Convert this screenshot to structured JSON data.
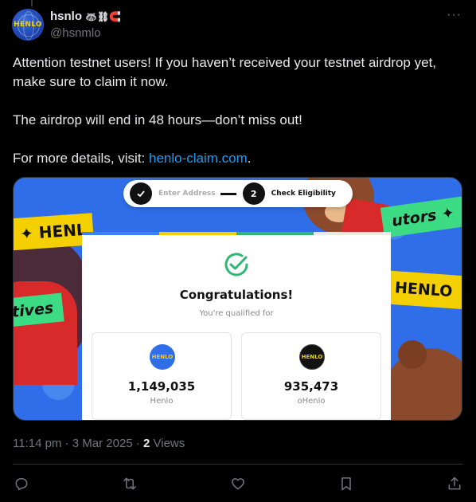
{
  "author": {
    "display_name": "hsnlo",
    "display_emojis": "🦝⛓🧲",
    "handle": "@hsnmlo",
    "avatar_text": "HENLO"
  },
  "more_label": "···",
  "tweet": {
    "line1": "Attention testnet users! If you haven’t received your testnet airdrop yet, make sure to claim it now.",
    "line2": "The airdrop will end in 48 hours—don’t miss out!",
    "line3_prefix": "For more details, visit: ",
    "line3_link": "henlo-claim.com",
    "line3_suffix": "."
  },
  "media": {
    "stepper": {
      "step1_icon": "check-icon",
      "step1_label": "Enter Address",
      "step2_number": "2",
      "step2_label": "Check Eligibility"
    },
    "banners": {
      "left": "✦ HENL",
      "right_top": "utors ✦",
      "right_mid": "HENLO",
      "left_mid": "tives"
    },
    "card": {
      "title": "Congratulations!",
      "subtitle": "You're qualified for",
      "tokens": [
        {
          "logo_text": "HENLO",
          "amount": "1,149,035",
          "name": "Henlo"
        },
        {
          "logo_text": "HENLO",
          "amount": "935,473",
          "name": "oHenlo"
        }
      ]
    },
    "colors": {
      "background": "#2f6ee8",
      "banner_yellow": "#f5d000",
      "banner_green": "#3ddc84",
      "check_green": "#2eb872"
    }
  },
  "meta": {
    "time": "11:14 pm",
    "separator": " · ",
    "date": "3 Mar 2025",
    "views_count": "2",
    "views_label": " Views"
  },
  "actions": [
    "reply-icon",
    "repost-icon",
    "like-icon",
    "bookmark-icon",
    "share-icon"
  ],
  "theme": {
    "background": "#000000",
    "text": "#e7e9ea",
    "muted": "#71767b",
    "link": "#1d9bf0"
  }
}
